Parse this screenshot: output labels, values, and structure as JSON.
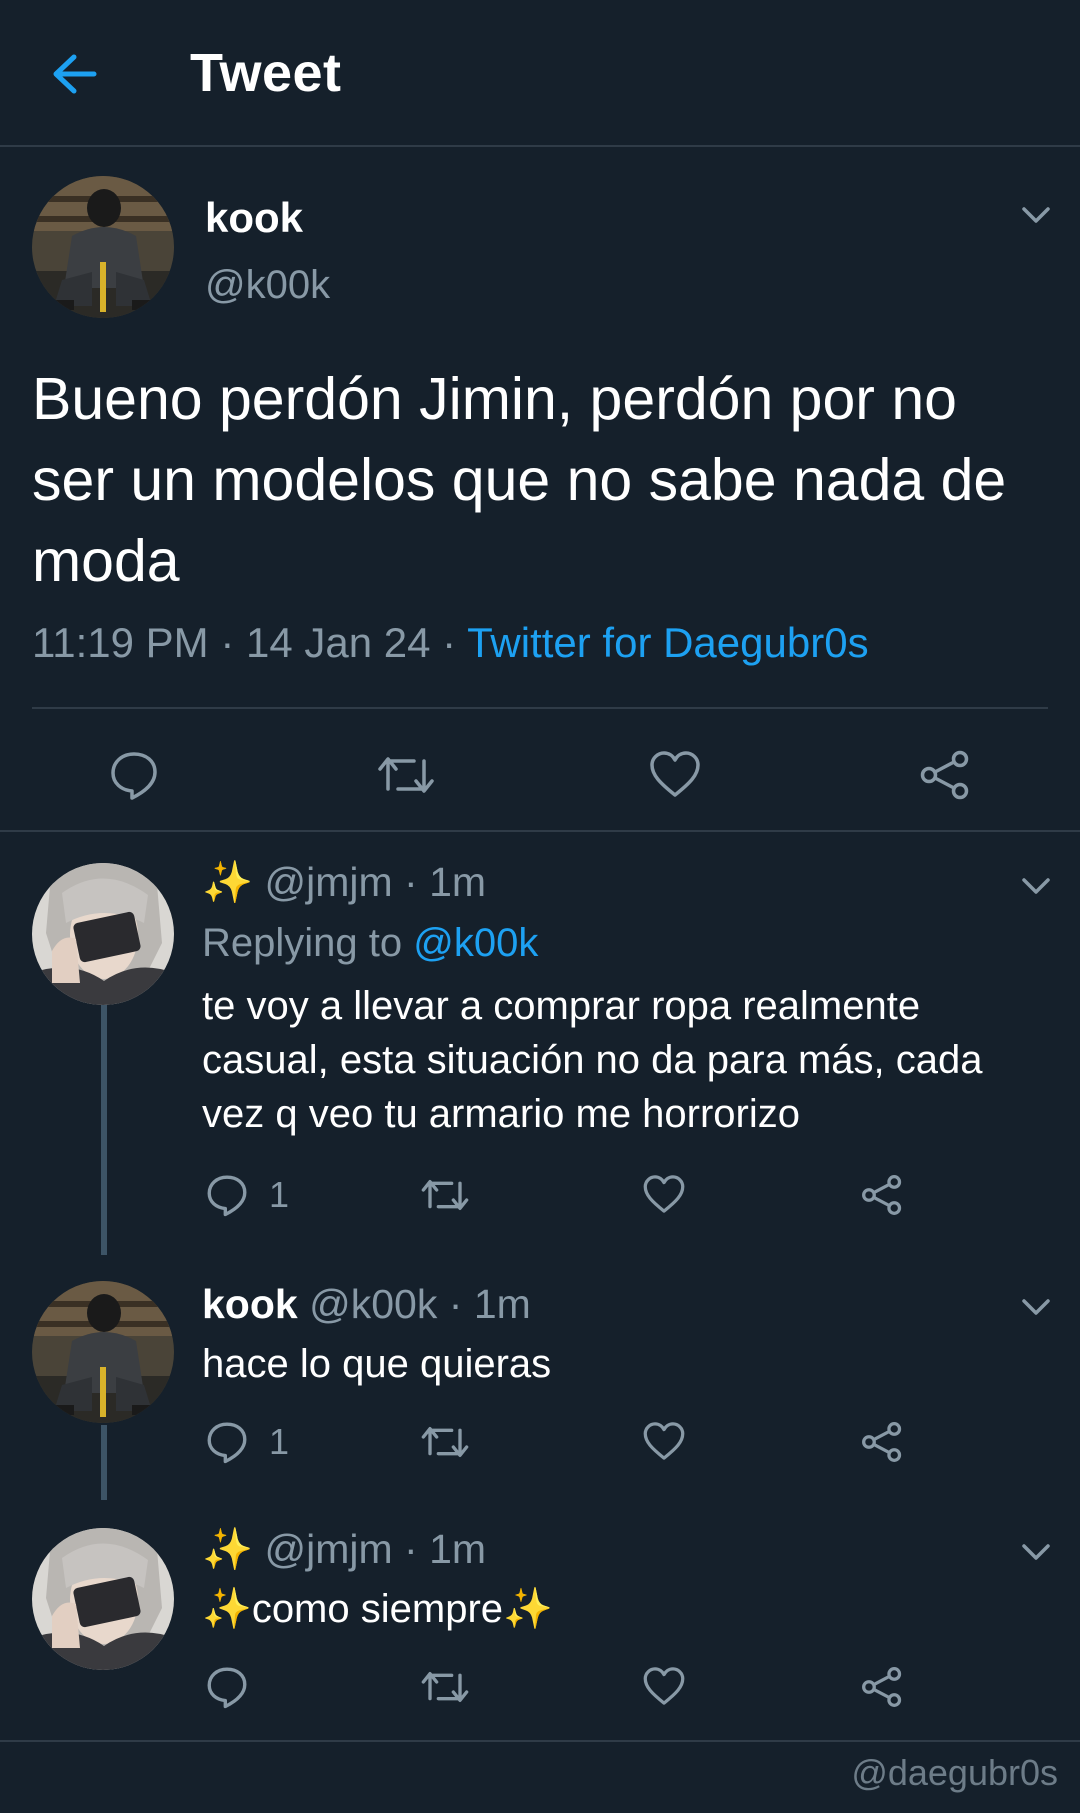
{
  "header": {
    "title": "Tweet",
    "back_icon": "arrow-left-icon",
    "accent": "#1da1f2"
  },
  "main_tweet": {
    "name": "kook",
    "handle": "@k00k",
    "text": "Bueno perdón Jimin, perdón por no ser un modelos que no sabe nada de moda",
    "time": "11:19 PM",
    "date": "14 Jan 24",
    "source": "Twitter for Daegubr0s",
    "separator": " · "
  },
  "replies": [
    {
      "sparkle": "✨",
      "handle": "@jmjm",
      "time": "1m",
      "replying_label": "Replying to ",
      "replying_to": "@k00k",
      "text": "te voy a llevar a comprar ropa realmente casual, esta situación no da para más, cada vez q veo tu armario me horrorizo",
      "reply_count": "1"
    },
    {
      "name": "kook",
      "handle": "@k00k",
      "time": "1m",
      "text": "hace lo que quieras",
      "reply_count": "1"
    },
    {
      "sparkle": "✨",
      "handle": "@jmjm",
      "time": "1m",
      "text_prefix": "✨",
      "text": "como siempre",
      "text_suffix": "✨",
      "reply_count": ""
    }
  ],
  "watermark": "@daegubr0s",
  "colors": {
    "background": "#15202b",
    "secondary_text": "#8899a6",
    "divider": "#2f3b47",
    "link": "#1da1f2"
  }
}
